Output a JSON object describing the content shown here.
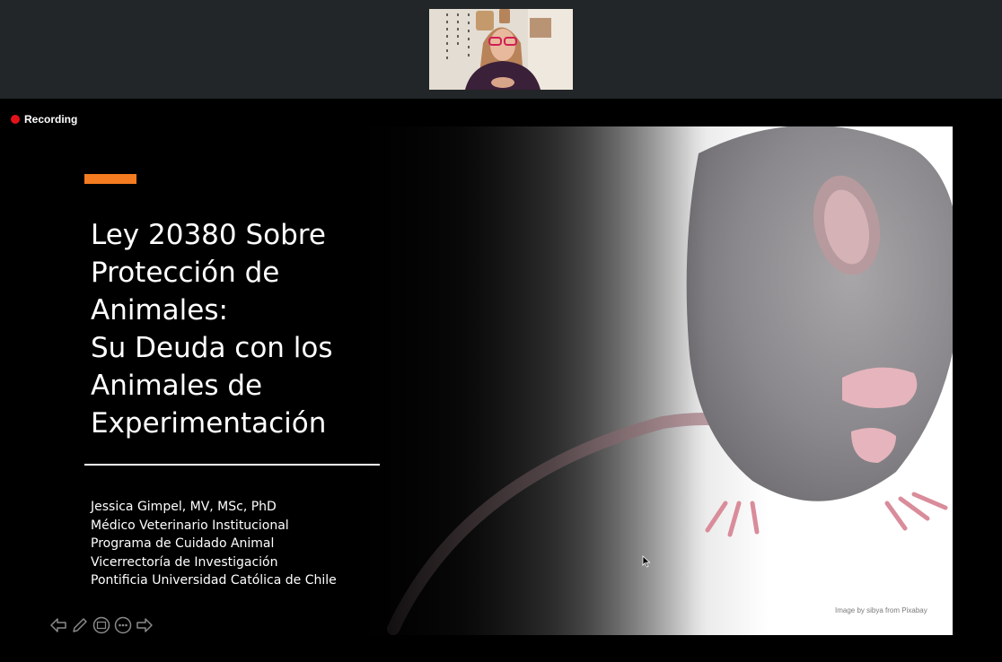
{
  "recording": {
    "label": "Recording"
  },
  "slide": {
    "title": "Ley 20380 Sobre\nProtección de\nAnimales:\nSu Deuda con los\nAnimales de\nExperimentación",
    "presenter_lines": [
      "Jessica Gimpel, MV, MSc, PhD",
      "Médico Veterinario Institucional",
      "Programa de Cuidado Animal",
      "Vicerrectoría de Investigación",
      "Pontificia Universidad Católica de Chile"
    ],
    "image_credit": "Image by sibya from Pixabay",
    "image_subject": "mouse-covering-face-photo"
  },
  "controls": {
    "icons": [
      "previous-icon",
      "pen-icon",
      "slides-icon",
      "more-icon",
      "next-icon"
    ]
  },
  "colors": {
    "accent": "#f47b20",
    "recording": "#e3131a",
    "top_bar": "#232628"
  }
}
